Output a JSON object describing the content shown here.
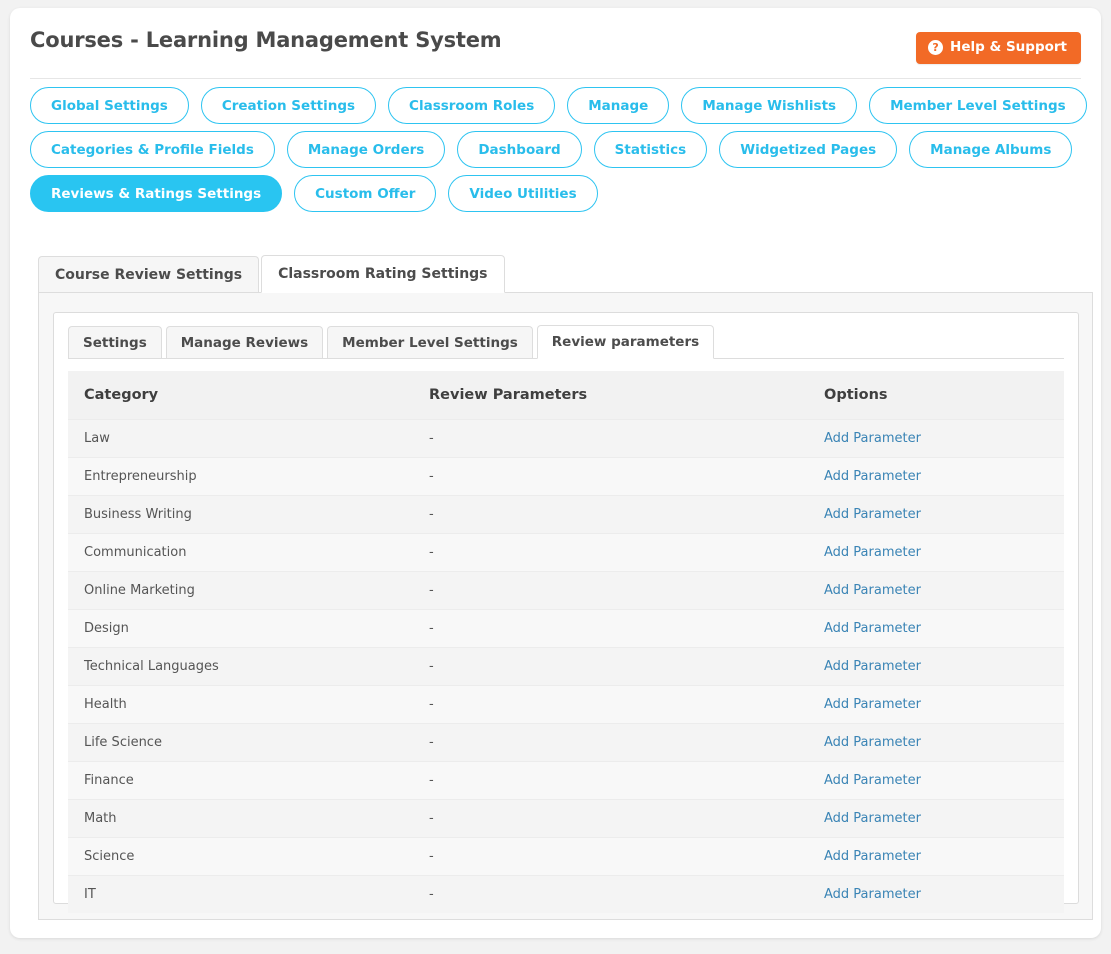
{
  "header": {
    "title": "Courses - Learning Management System",
    "help_button": {
      "label": "Help & Support",
      "icon": "question-circle-icon",
      "glyph": "?",
      "color": "#f26a26"
    }
  },
  "nav_pills": {
    "accent_color": "#29bdeb",
    "active_color": "#29c5f1",
    "rows": [
      [
        "Global Settings",
        "Creation Settings",
        "Classroom Roles",
        "Manage",
        "Manage Wishlists",
        "Member Level Settings"
      ],
      [
        "Categories & Profile Fields",
        "Manage Orders",
        "Dashboard",
        "Statistics",
        "Widgetized Pages",
        "Manage Albums"
      ],
      [
        "Reviews & Ratings Settings",
        "Custom Offer",
        "Video Utilities"
      ]
    ],
    "active": "Reviews & Ratings Settings"
  },
  "outer_tabs": {
    "items": [
      {
        "label": "Course Review Settings",
        "active": false
      },
      {
        "label": "Classroom Rating Settings",
        "active": true
      }
    ]
  },
  "inner_tabs": {
    "items": [
      {
        "label": "Settings",
        "active": false
      },
      {
        "label": "Manage Reviews",
        "active": false
      },
      {
        "label": "Member Level Settings",
        "active": false
      },
      {
        "label": "Review parameters",
        "active": true
      }
    ]
  },
  "table": {
    "columns": [
      "Category",
      "Review Parameters",
      "Options"
    ],
    "link_label": "Add Parameter",
    "link_color": "#3a84b5",
    "empty_value": "-",
    "rows": [
      {
        "category": "Law",
        "parameters": "-",
        "option": "Add Parameter"
      },
      {
        "category": "Entrepreneurship",
        "parameters": "-",
        "option": "Add Parameter"
      },
      {
        "category": "Business Writing",
        "parameters": "-",
        "option": "Add Parameter"
      },
      {
        "category": "Communication",
        "parameters": "-",
        "option": "Add Parameter"
      },
      {
        "category": "Online Marketing",
        "parameters": "-",
        "option": "Add Parameter"
      },
      {
        "category": "Design",
        "parameters": "-",
        "option": "Add Parameter"
      },
      {
        "category": "Technical Languages",
        "parameters": "-",
        "option": "Add Parameter"
      },
      {
        "category": "Health",
        "parameters": "-",
        "option": "Add Parameter"
      },
      {
        "category": "Life Science",
        "parameters": "-",
        "option": "Add Parameter"
      },
      {
        "category": "Finance",
        "parameters": "-",
        "option": "Add Parameter"
      },
      {
        "category": "Math",
        "parameters": "-",
        "option": "Add Parameter"
      },
      {
        "category": "Science",
        "parameters": "-",
        "option": "Add Parameter"
      },
      {
        "category": "IT",
        "parameters": "-",
        "option": "Add Parameter"
      }
    ]
  }
}
